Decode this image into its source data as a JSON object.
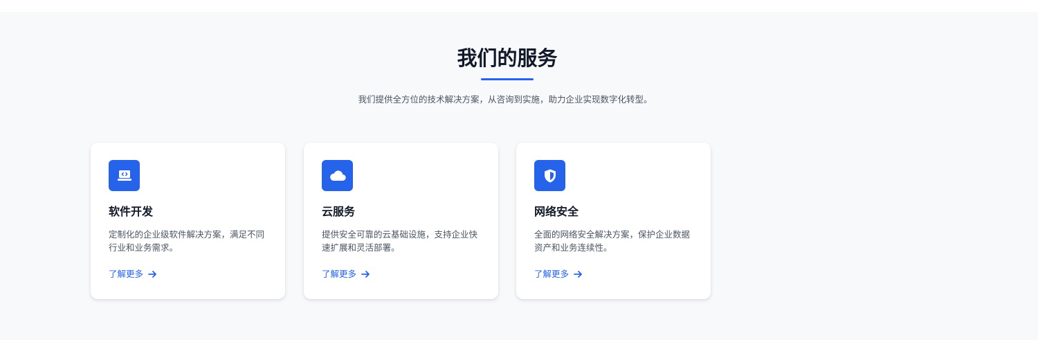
{
  "section": {
    "title": "我们的服务",
    "subtitle": "我们提供全方位的技术解决方案，从咨询到实施，助力企业实现数字化转型。",
    "accent_color": "#2563eb"
  },
  "services": [
    {
      "icon": "laptop-code-icon",
      "title": "软件开发",
      "description": "定制化的企业级软件解决方案，满足不同行业和业务需求。",
      "link_label": "了解更多"
    },
    {
      "icon": "cloud-icon",
      "title": "云服务",
      "description": "提供安全可靠的云基础设施，支持企业快速扩展和灵活部署。",
      "link_label": "了解更多"
    },
    {
      "icon": "shield-icon",
      "title": "网络安全",
      "description": "全面的网络安全解决方案，保护企业数据资产和业务连续性。",
      "link_label": "了解更多"
    }
  ]
}
